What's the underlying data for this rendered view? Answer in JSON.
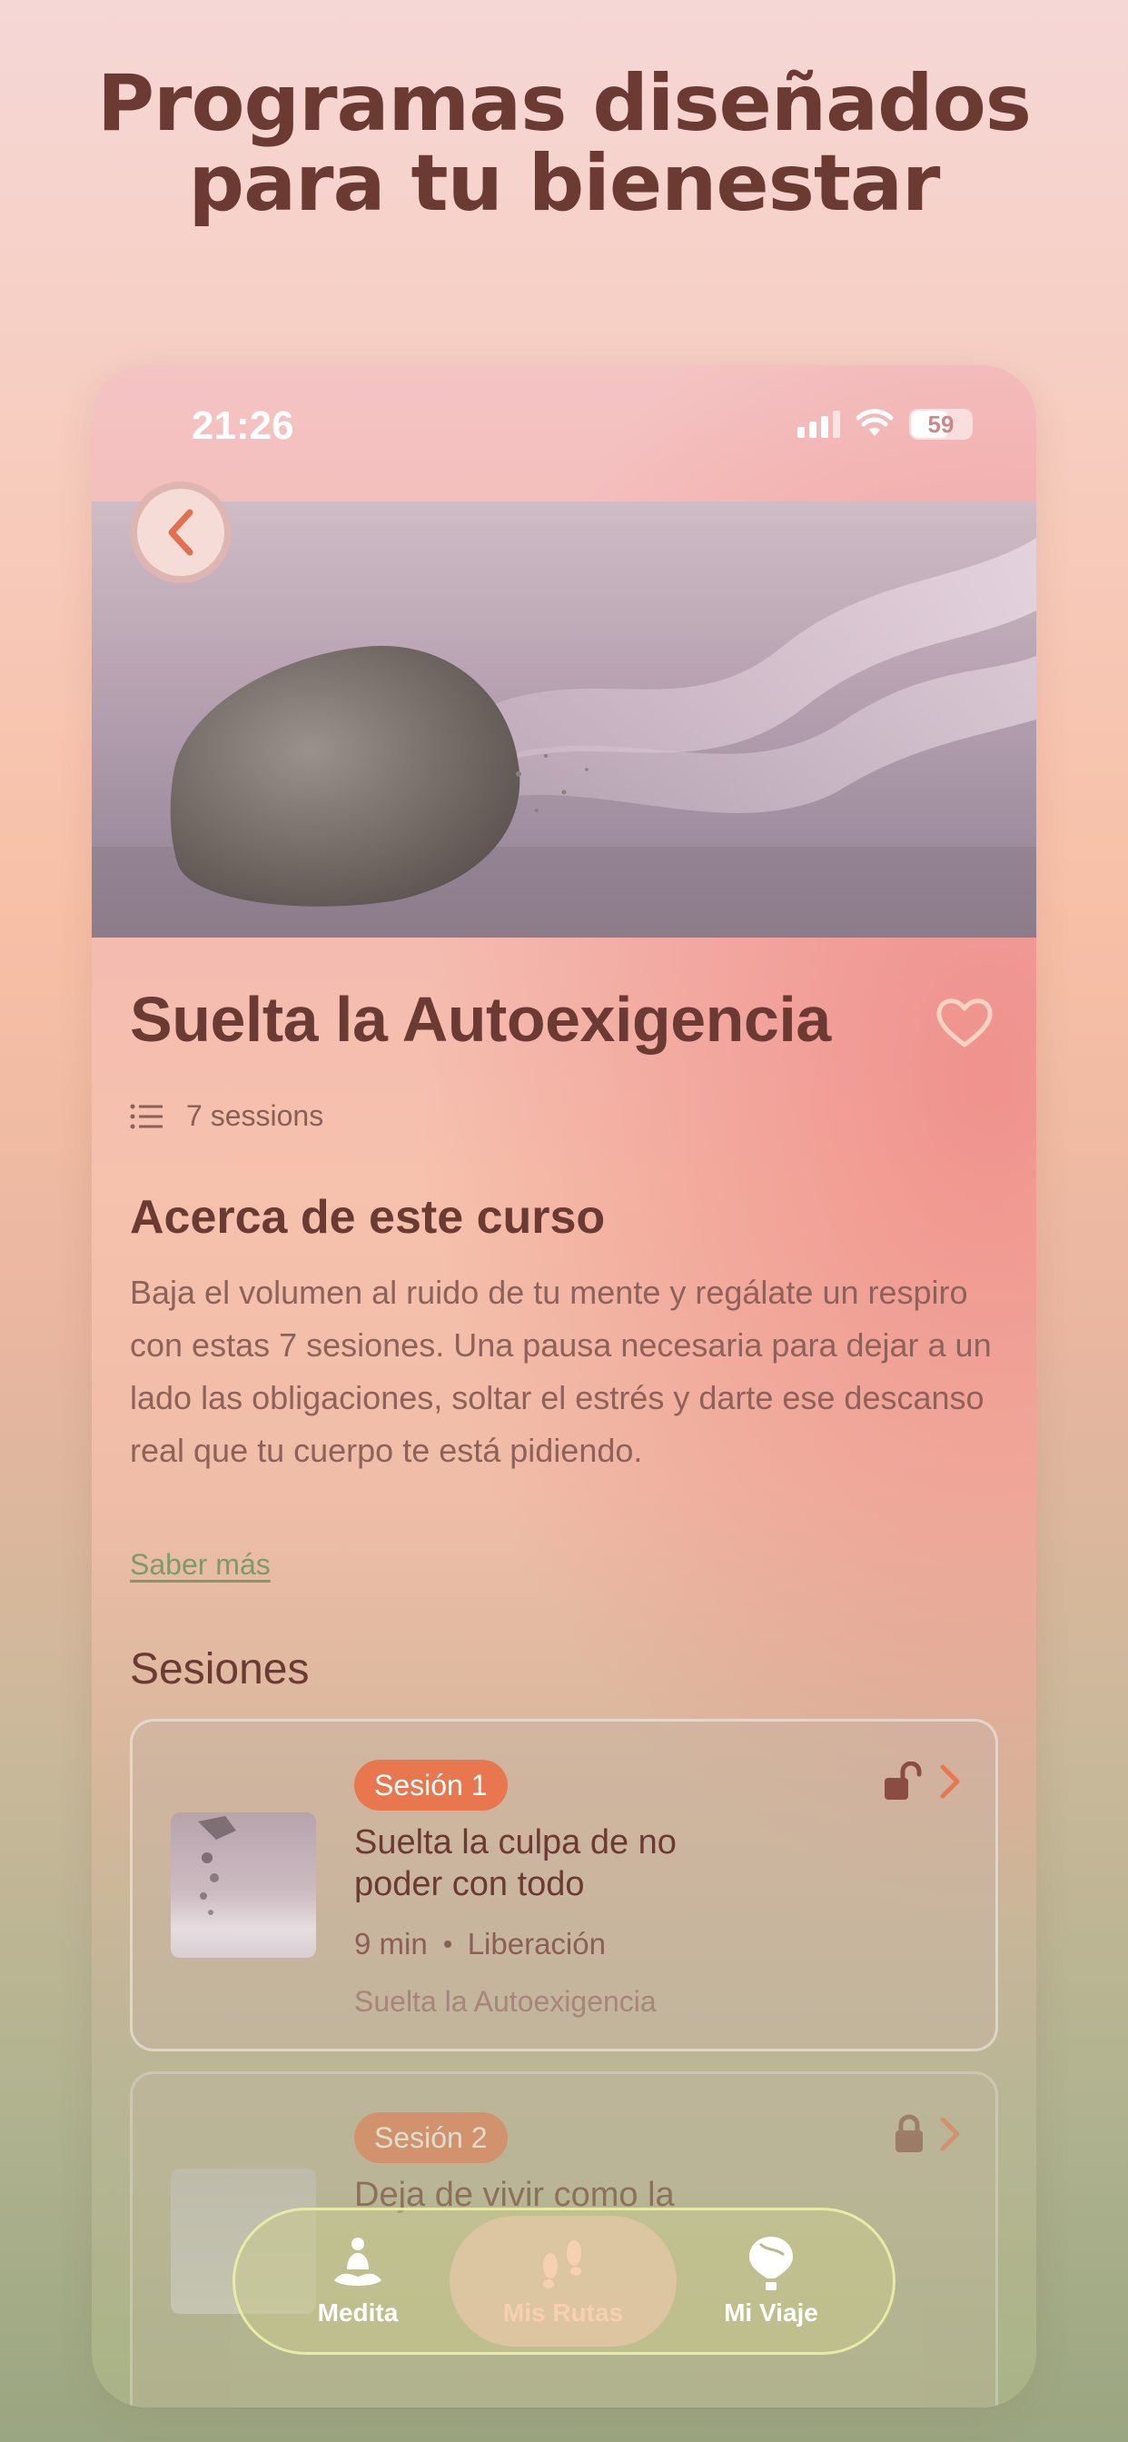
{
  "marketing": {
    "line1": "Programas diseñados",
    "line2": "para tu bienestar"
  },
  "status_bar": {
    "time": "21:26",
    "battery": "59"
  },
  "course": {
    "title": "Suelta la Autoexigencia",
    "sessions_count": "7 sessions",
    "about_title": "Acerca de este curso",
    "about_text": "Baja el volumen al ruido de tu mente y regálate un respiro con estas 7 sesiones. Una pausa necesaria para dejar a un lado las obligaciones, soltar el estrés y darte ese descanso real que tu cuerpo te está pidiendo.",
    "read_more": "Saber más",
    "sessions_header": "Sesiones"
  },
  "sessions": [
    {
      "badge": "Sesión 1",
      "title": "Suelta la culpa de no poder con todo",
      "duration": "9 min",
      "category": "Liberación",
      "course": "Suelta la Autoexigencia",
      "lock": "unlocked"
    },
    {
      "badge": "Sesión 2",
      "title": "Deja de vivir como la",
      "lock": "locked"
    }
  ],
  "tab_bar": {
    "items": [
      {
        "label": "Medita",
        "icon": "meditation-icon"
      },
      {
        "label": "Mis Rutas",
        "icon": "footprints-icon",
        "active": true
      },
      {
        "label": "Mi Viaje",
        "icon": "balloon-icon"
      }
    ]
  },
  "colors": {
    "title_brown": "#6b3a32",
    "badge_orange": "#e8774f",
    "accent_green": "#7f9a6a"
  }
}
